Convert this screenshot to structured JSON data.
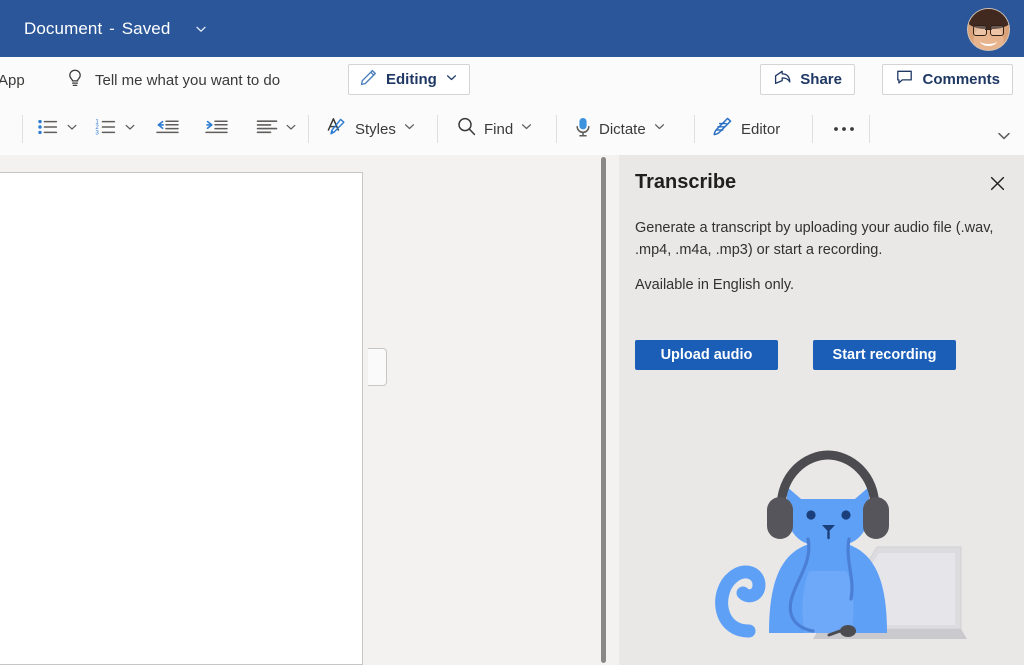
{
  "titlebar": {
    "document_name": "Document",
    "separator": "-",
    "save_state": "Saved",
    "chevron_icon": "chevron-down-icon",
    "avatar_alt": "user-avatar",
    "background_color": "#2b579a"
  },
  "commandbar": {
    "app_label": "App",
    "lightbulb_icon": "lightbulb-icon",
    "tell_me_label": "Tell me what you want to do",
    "editing": {
      "label": "Editing",
      "icon": "pencil-icon",
      "chevron_icon": "chevron-down-icon"
    },
    "share": {
      "label": "Share",
      "icon": "share-icon"
    },
    "comments": {
      "label": "Comments",
      "icon": "comment-bubble-icon"
    }
  },
  "ribbon": {
    "items": [
      {
        "name": "bullet-list",
        "icon": "bullet-list-icon",
        "has_chevron": true,
        "label": ""
      },
      {
        "name": "numbered-list",
        "icon": "numbered-list-icon",
        "has_chevron": true,
        "label": ""
      },
      {
        "name": "decrease-indent",
        "icon": "decrease-indent-icon",
        "has_chevron": false,
        "label": ""
      },
      {
        "name": "increase-indent",
        "icon": "increase-indent-icon",
        "has_chevron": false,
        "label": ""
      },
      {
        "name": "align",
        "icon": "align-left-icon",
        "has_chevron": true,
        "label": ""
      },
      {
        "name": "styles",
        "icon": "styles-icon",
        "has_chevron": true,
        "label": "Styles"
      },
      {
        "name": "find",
        "icon": "search-icon",
        "has_chevron": true,
        "label": "Find"
      },
      {
        "name": "dictate",
        "icon": "microphone-icon",
        "has_chevron": true,
        "label": "Dictate"
      },
      {
        "name": "editor",
        "icon": "editor-pen-icon",
        "has_chevron": false,
        "label": "Editor"
      },
      {
        "name": "more-options",
        "icon": "ellipsis-icon",
        "has_chevron": false,
        "label": ""
      }
    ],
    "collapse_icon": "chevron-down-icon"
  },
  "document": {
    "page_handle_icon": "comment-anchor-handle",
    "scrollbar": "vertical-scrollbar"
  },
  "panel": {
    "title": "Transcribe",
    "close_icon": "close-icon",
    "description": "Generate a transcript by uploading your audio file (.wav, .mp4, .m4a, .mp3) or start a recording.",
    "note": "Available in English only.",
    "upload_button_label": "Upload audio",
    "record_button_label": "Start recording",
    "accent_color": "#1a5eb8",
    "background_color": "#eae8e6",
    "illustration_name": "cat-with-headphones-and-laptop-illustration"
  }
}
